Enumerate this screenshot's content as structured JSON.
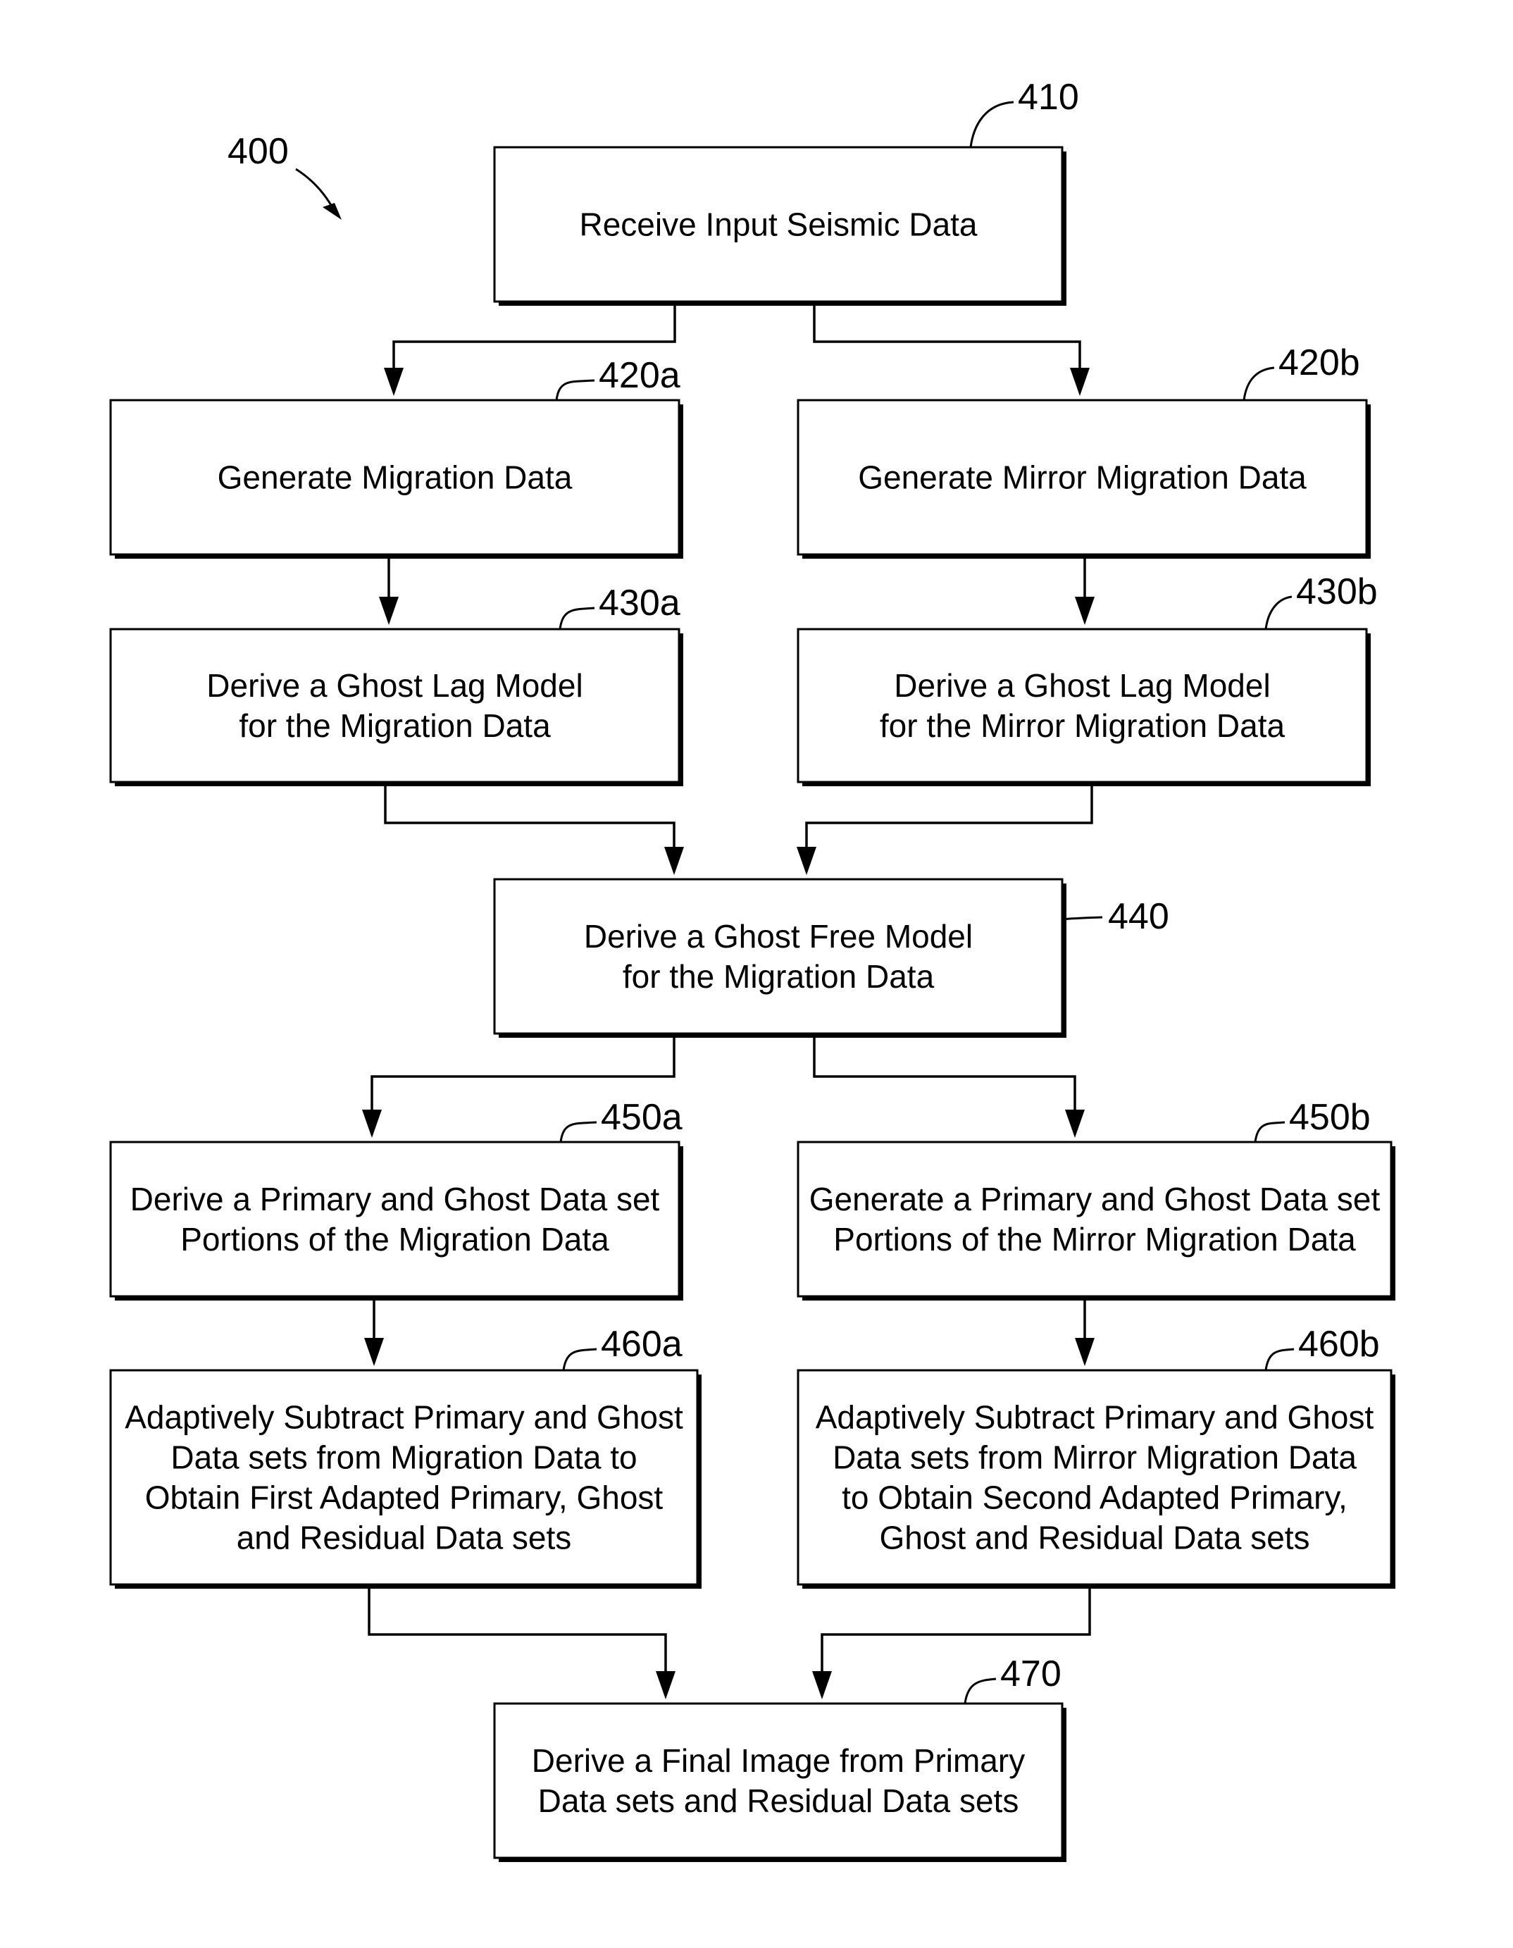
{
  "figure": {
    "label": "400",
    "nodes": [
      {
        "id": "410",
        "ref": "410",
        "lines": [
          "Receive Input Seismic Data"
        ]
      },
      {
        "id": "420a",
        "ref": "420a",
        "lines": [
          "Generate Migration Data"
        ]
      },
      {
        "id": "420b",
        "ref": "420b",
        "lines": [
          "Generate Mirror Migration Data"
        ]
      },
      {
        "id": "430a",
        "ref": "430a",
        "lines": [
          "Derive a Ghost Lag Model",
          "for the Migration Data"
        ]
      },
      {
        "id": "430b",
        "ref": "430b",
        "lines": [
          "Derive a Ghost Lag Model",
          "for the Mirror Migration Data"
        ]
      },
      {
        "id": "440",
        "ref": "440",
        "lines": [
          "Derive a Ghost Free Model",
          "for the Migration Data"
        ]
      },
      {
        "id": "450a",
        "ref": "450a",
        "lines": [
          "Derive a Primary and Ghost Data set",
          "Portions of the Migration Data"
        ]
      },
      {
        "id": "450b",
        "ref": "450b",
        "lines": [
          "Generate a Primary and Ghost Data set",
          "Portions of the Mirror Migration Data"
        ]
      },
      {
        "id": "460a",
        "ref": "460a",
        "lines": [
          "Adaptively Subtract Primary and Ghost",
          "Data sets from Migration Data to",
          "Obtain First Adapted Primary, Ghost",
          "and Residual Data sets"
        ]
      },
      {
        "id": "460b",
        "ref": "460b",
        "lines": [
          "Adaptively Subtract Primary and Ghost",
          "Data sets from Mirror Migration Data",
          "to Obtain Second Adapted Primary,",
          "Ghost and Residual Data sets"
        ]
      },
      {
        "id": "470",
        "ref": "470",
        "lines": [
          "Derive a Final Image from Primary",
          "Data sets and Residual Data sets"
        ]
      }
    ],
    "edges": [
      {
        "from": "410",
        "to": "420a"
      },
      {
        "from": "410",
        "to": "420b"
      },
      {
        "from": "420a",
        "to": "430a"
      },
      {
        "from": "420b",
        "to": "430b"
      },
      {
        "from": "430a",
        "to": "440"
      },
      {
        "from": "430b",
        "to": "440"
      },
      {
        "from": "440",
        "to": "450a"
      },
      {
        "from": "440",
        "to": "450b"
      },
      {
        "from": "450a",
        "to": "460a"
      },
      {
        "from": "450b",
        "to": "460b"
      },
      {
        "from": "460a",
        "to": "470"
      },
      {
        "from": "460b",
        "to": "470"
      }
    ]
  }
}
